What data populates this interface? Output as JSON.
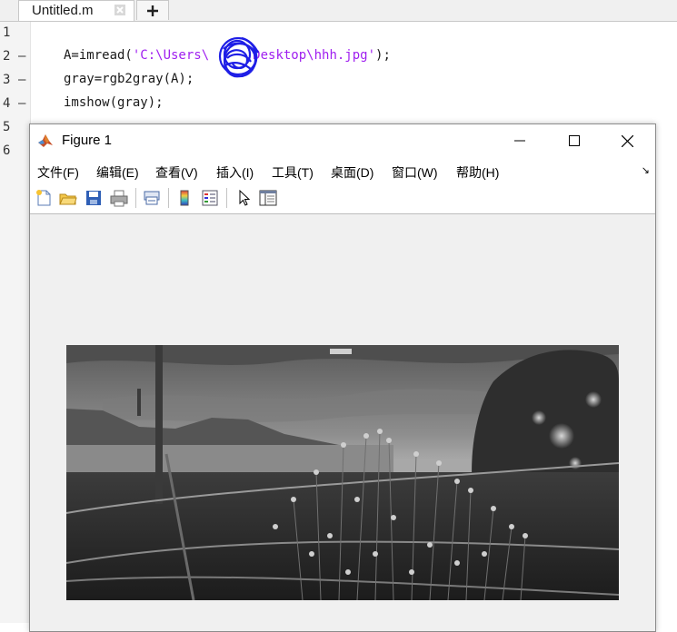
{
  "editor": {
    "tab_label": "Untitled.m",
    "line_numbers": [
      "1",
      "2",
      "3",
      "4",
      "5",
      "6"
    ],
    "line_dashes": [
      "—",
      "—",
      "—"
    ],
    "line2": {
      "prefix": "A=imread(",
      "string": "'C:\\Users\\",
      "string_tail": "Desktop\\hhh.jpg'",
      "suffix": ");"
    },
    "line3": "gray=rgb2gray(A);",
    "line4": "imshow(gray);"
  },
  "figure": {
    "title": "Figure 1",
    "menu": [
      "文件(F)",
      "编辑(E)",
      "查看(V)",
      "插入(I)",
      "工具(T)",
      "桌面(D)",
      "窗口(W)",
      "帮助(H)"
    ],
    "menu_overflow_icon": "↘",
    "toolbar_icons": [
      "new-figure-icon",
      "open-file-icon",
      "save-icon",
      "print-icon",
      "link-plot-icon",
      "insert-colorbar-icon",
      "insert-legend-icon",
      "edit-plot-arrow-icon",
      "property-inspector-icon"
    ],
    "image_description_color": "#808080"
  },
  "colors": {
    "string": "#a020f0",
    "scribble": "#1e1ee6"
  }
}
